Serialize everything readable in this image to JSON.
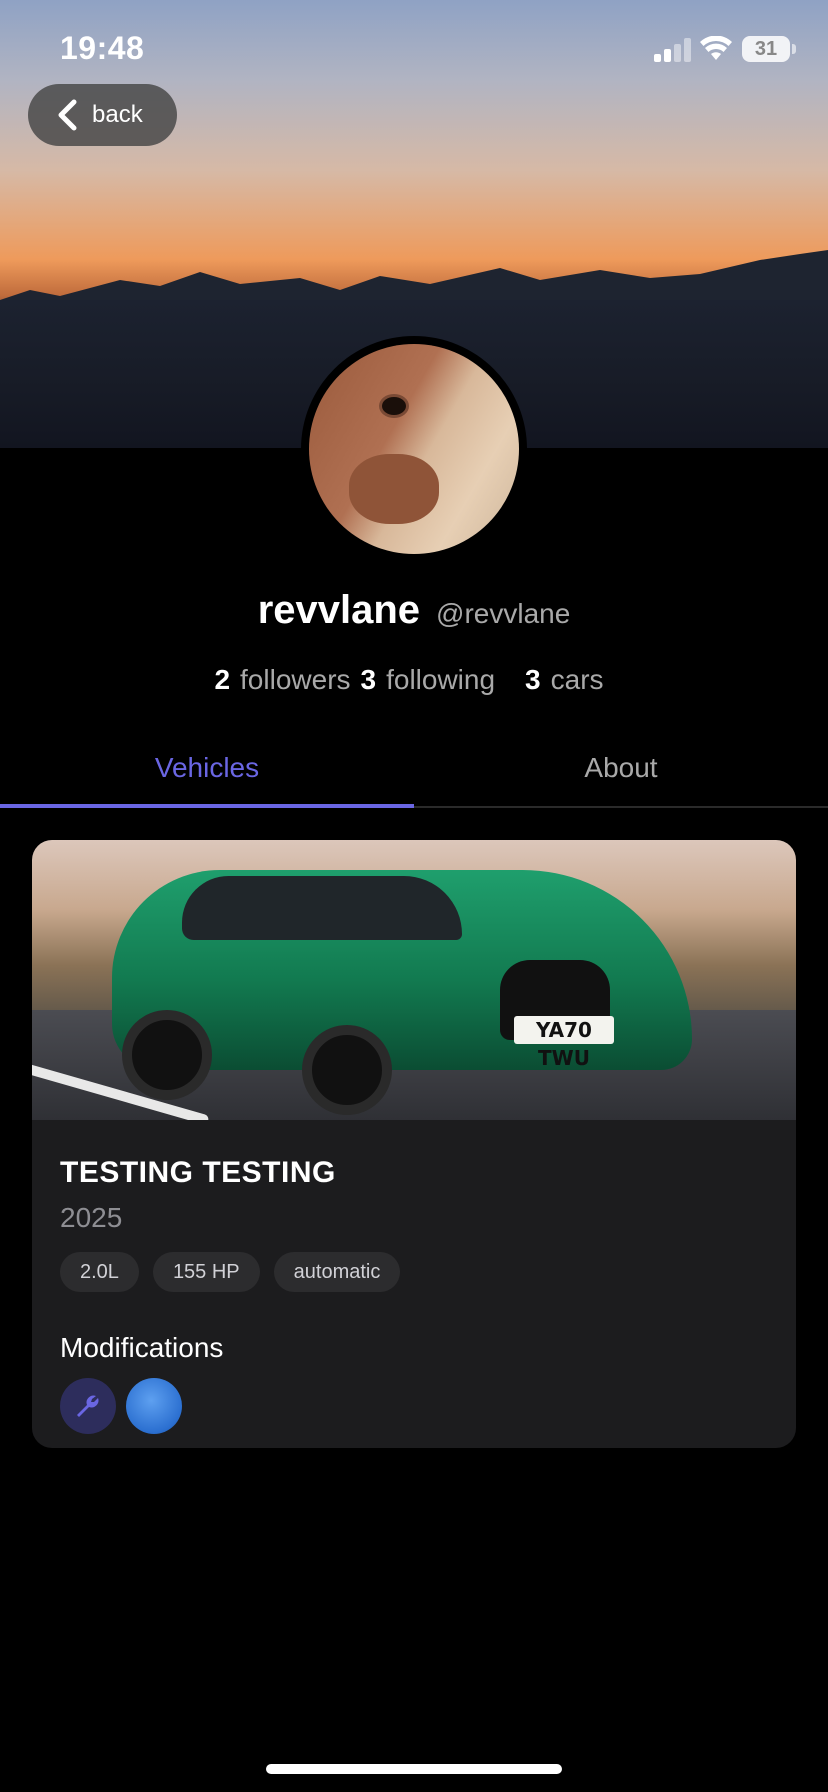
{
  "status_bar": {
    "time": "19:48",
    "battery": "31"
  },
  "nav": {
    "back_label": "back"
  },
  "profile": {
    "username": "revvlane",
    "handle": "@revvlane",
    "followers_count": "2",
    "followers_label": "followers",
    "following_count": "3",
    "following_label": "following",
    "cars_count": "3",
    "cars_label": "cars"
  },
  "tabs": [
    {
      "label": "Vehicles",
      "active": true
    },
    {
      "label": "About",
      "active": false
    }
  ],
  "vehicle": {
    "plate": "YA70 TWU",
    "title": "TESTING TESTING",
    "year": "2025",
    "specs": [
      "2.0L",
      "155 HP",
      "automatic"
    ],
    "modifications_heading": "Modifications"
  },
  "colors": {
    "accent": "#6a66e3",
    "card_bg": "#1c1c1e",
    "chip_bg": "#2c2c2e",
    "secondary_text": "#a9a9a9"
  },
  "icons": {
    "back": "chevron-left-icon",
    "wifi": "wifi-icon",
    "signal": "signal-icon",
    "battery": "battery-icon",
    "mod_1": "wrench-icon",
    "mod_2": "modification-icon"
  }
}
